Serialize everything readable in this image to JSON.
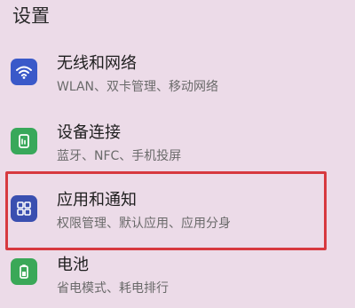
{
  "page": {
    "title": "设置"
  },
  "items": [
    {
      "label": "无线和网络",
      "sub": "WLAN、双卡管理、移动网络",
      "icon": "wifi-icon",
      "icon_color": "#3a59c9"
    },
    {
      "label": "设备连接",
      "sub": "蓝牙、NFC、手机投屏",
      "icon": "device-connection-icon",
      "icon_color": "#38a85a"
    },
    {
      "label": "应用和通知",
      "sub": "权限管理、默认应用、应用分身",
      "icon": "apps-icon",
      "icon_color": "#3a4fb0"
    },
    {
      "label": "电池",
      "sub": "省电模式、耗电排行",
      "icon": "battery-icon",
      "icon_color": "#3aa858"
    }
  ],
  "colors": {
    "background": "#ecdbe8",
    "highlight_border": "#d7393f"
  }
}
